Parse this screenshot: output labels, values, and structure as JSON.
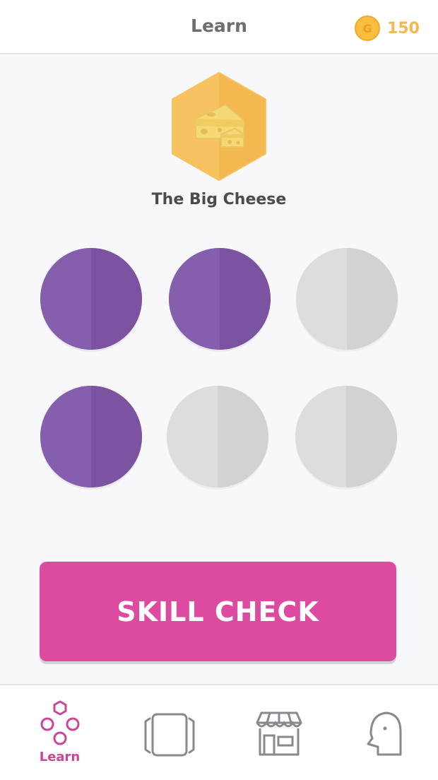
{
  "header": {
    "title": "Learn",
    "coin_icon": "coin-icon",
    "coin_letter": "G",
    "coin_count": "150"
  },
  "badge": {
    "name": "The Big Cheese",
    "icon": "cheese-icon",
    "color": "#f6b94f"
  },
  "lessons": [
    {
      "state": "completed"
    },
    {
      "state": "completed"
    },
    {
      "state": "incomplete"
    },
    {
      "state": "completed"
    },
    {
      "state": "incomplete"
    },
    {
      "state": "incomplete"
    }
  ],
  "skill_check": {
    "label": "SKILL CHECK",
    "color": "#dc4ba0"
  },
  "bottom_nav": {
    "items": [
      {
        "label": "Learn",
        "icon": "learn-hexagon-circles-icon",
        "active": true
      },
      {
        "label": "",
        "icon": "flashcards-icon",
        "active": false
      },
      {
        "label": "",
        "icon": "store-icon",
        "active": false
      },
      {
        "label": "",
        "icon": "profile-head-icon",
        "active": false
      }
    ],
    "active_color": "#cc4596",
    "inactive_color": "#8a888c"
  }
}
